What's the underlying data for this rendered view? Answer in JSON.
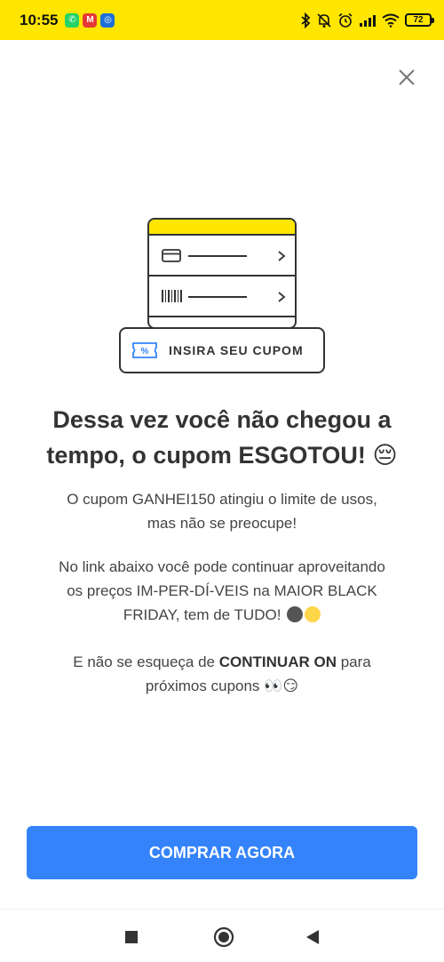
{
  "status_bar": {
    "time": "10:55",
    "apps": [
      "whatsapp-icon",
      "mercadolivre-icon",
      "google-drive-icon"
    ],
    "battery": "72"
  },
  "illustration": {
    "coupon_label": "INSIRA SEU CUPOM"
  },
  "title_line1": "Dessa vez você não chegou a",
  "title_line2": "tempo, o cupom ESGOTOU!",
  "title_emoji": "😔",
  "paragraph1_line1": "O cupom GANHEI150 atingiu o limite de usos,",
  "paragraph1_line2": "mas não se preocupe!",
  "paragraph2_line1": "No link abaixo você pode continuar aproveitando",
  "paragraph2_line2": "os preços IM-PER-DÍ-VEIS na MAIOR BLACK",
  "paragraph2_line3": "FRIDAY, tem de TUDO!",
  "paragraph3_prefix": "E não se esqueça de ",
  "paragraph3_bold": "CONTINUAR ON",
  "paragraph3_suffix": " para",
  "paragraph3_line2": "próximos cupons",
  "paragraph3_emoji": "👀😏",
  "cta_label": "COMPRAR AGORA",
  "colors": {
    "status_bar": "#ffe600",
    "cta": "#3483fa",
    "text": "#333333"
  }
}
